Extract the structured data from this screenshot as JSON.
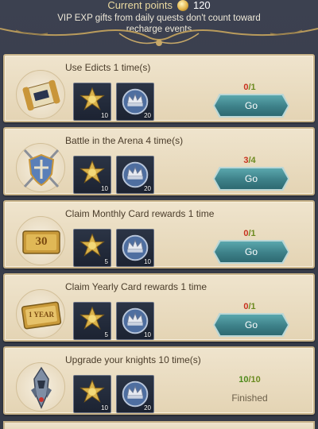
{
  "header": {
    "points_label": "Current points",
    "points_value": "120",
    "points_icon": "coin-icon",
    "notice": "VIP EXP gifts from daily quests don't count toward recharge events"
  },
  "tasks": [
    {
      "title": "Use Edicts 1 time(s)",
      "icon": "scroll-icon",
      "rewards": [
        {
          "icon": "star-medal-icon",
          "qty": "10"
        },
        {
          "icon": "crown-emblem-icon",
          "qty": "20"
        }
      ],
      "progress_current": "0",
      "progress_total": "1",
      "progress_state": "red",
      "action": "Go"
    },
    {
      "title": "Battle in the Arena 4 time(s)",
      "icon": "shield-swords-icon",
      "rewards": [
        {
          "icon": "star-medal-icon",
          "qty": "10"
        },
        {
          "icon": "crown-emblem-icon",
          "qty": "20"
        }
      ],
      "progress_current": "3",
      "progress_total": "4",
      "progress_state": "red",
      "action": "Go"
    },
    {
      "title": "Claim Monthly Card rewards 1 time",
      "icon": "monthly-card-icon",
      "card_text": "30",
      "rewards": [
        {
          "icon": "star-medal-icon",
          "qty": "5"
        },
        {
          "icon": "crown-emblem-icon",
          "qty": "10"
        }
      ],
      "progress_current": "0",
      "progress_total": "1",
      "progress_state": "red",
      "action": "Go"
    },
    {
      "title": "Claim Yearly Card rewards 1 time",
      "icon": "yearly-card-icon",
      "card_text": "1 YEAR",
      "rewards": [
        {
          "icon": "star-medal-icon",
          "qty": "5"
        },
        {
          "icon": "crown-emblem-icon",
          "qty": "10"
        }
      ],
      "progress_current": "0",
      "progress_total": "1",
      "progress_state": "red",
      "action": "Go"
    },
    {
      "title": "Upgrade your knights 10 time(s)",
      "icon": "knight-icon",
      "rewards": [
        {
          "icon": "star-medal-icon",
          "qty": "10"
        },
        {
          "icon": "crown-emblem-icon",
          "qty": "20"
        }
      ],
      "progress_current": "10",
      "progress_total": "10",
      "progress_state": "green",
      "status": "Finished"
    }
  ]
}
